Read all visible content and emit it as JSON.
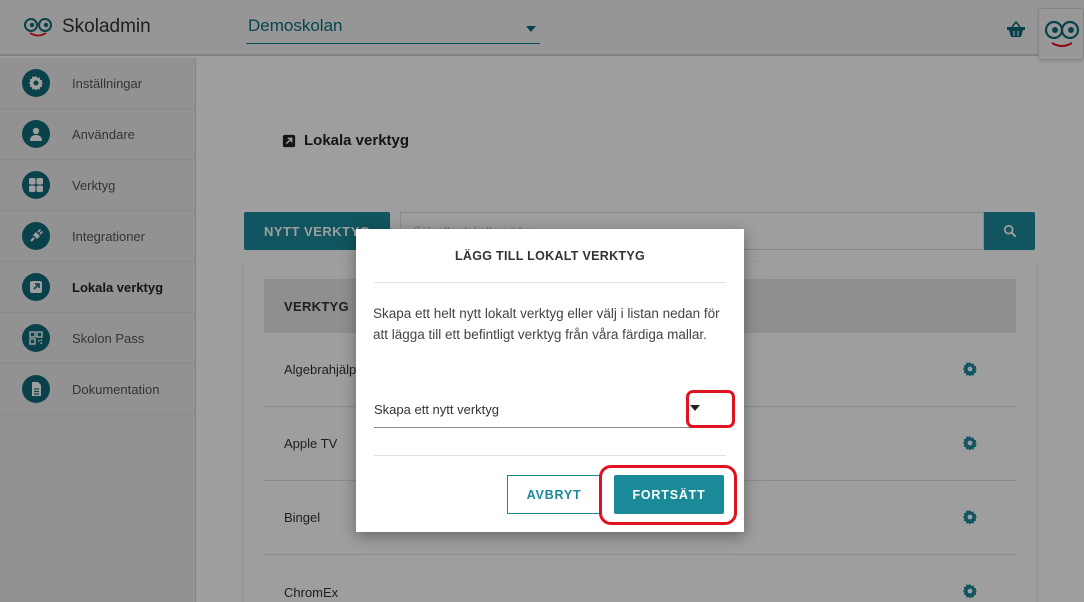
{
  "app": {
    "title": "Skoladmin",
    "school_selector": {
      "value": "Demoskolan"
    }
  },
  "sidebar": {
    "items": [
      {
        "label": "Inställningar",
        "icon": "gear-icon",
        "active": false
      },
      {
        "label": "Användare",
        "icon": "user-icon",
        "active": false
      },
      {
        "label": "Verktyg",
        "icon": "grid-icon",
        "active": false
      },
      {
        "label": "Integrationer",
        "icon": "plug-icon",
        "active": false
      },
      {
        "label": "Lokala verktyg",
        "icon": "external-link-icon",
        "active": true
      },
      {
        "label": "Skolon Pass",
        "icon": "qr-code-icon",
        "active": false
      },
      {
        "label": "Dokumentation",
        "icon": "document-icon",
        "active": false
      }
    ]
  },
  "main": {
    "heading": "Lokala verktyg",
    "new_button": "NYTT VERKTYG",
    "search": {
      "placeholder": "Sök efter lokalt verktyg"
    },
    "table": {
      "header": "VERKTYG",
      "rows": [
        "Algebrahjälpen",
        "Apple TV",
        "Bingel",
        "ChromEx"
      ]
    }
  },
  "modal": {
    "title": "LÄGG TILL LOKALT VERKTYG",
    "description": "Skapa ett helt nytt lokalt verktyg eller välj i listan nedan för att lägga till ett befintligt verktyg från våra färdiga mallar.",
    "select_value": "Skapa ett nytt verktyg",
    "cancel_label": "AVBRYT",
    "continue_label": "FORTSÄTT"
  },
  "colors": {
    "accent": "#1a8a99",
    "sidebar_icon": "#0f6b78",
    "highlight": "#e0121f"
  }
}
